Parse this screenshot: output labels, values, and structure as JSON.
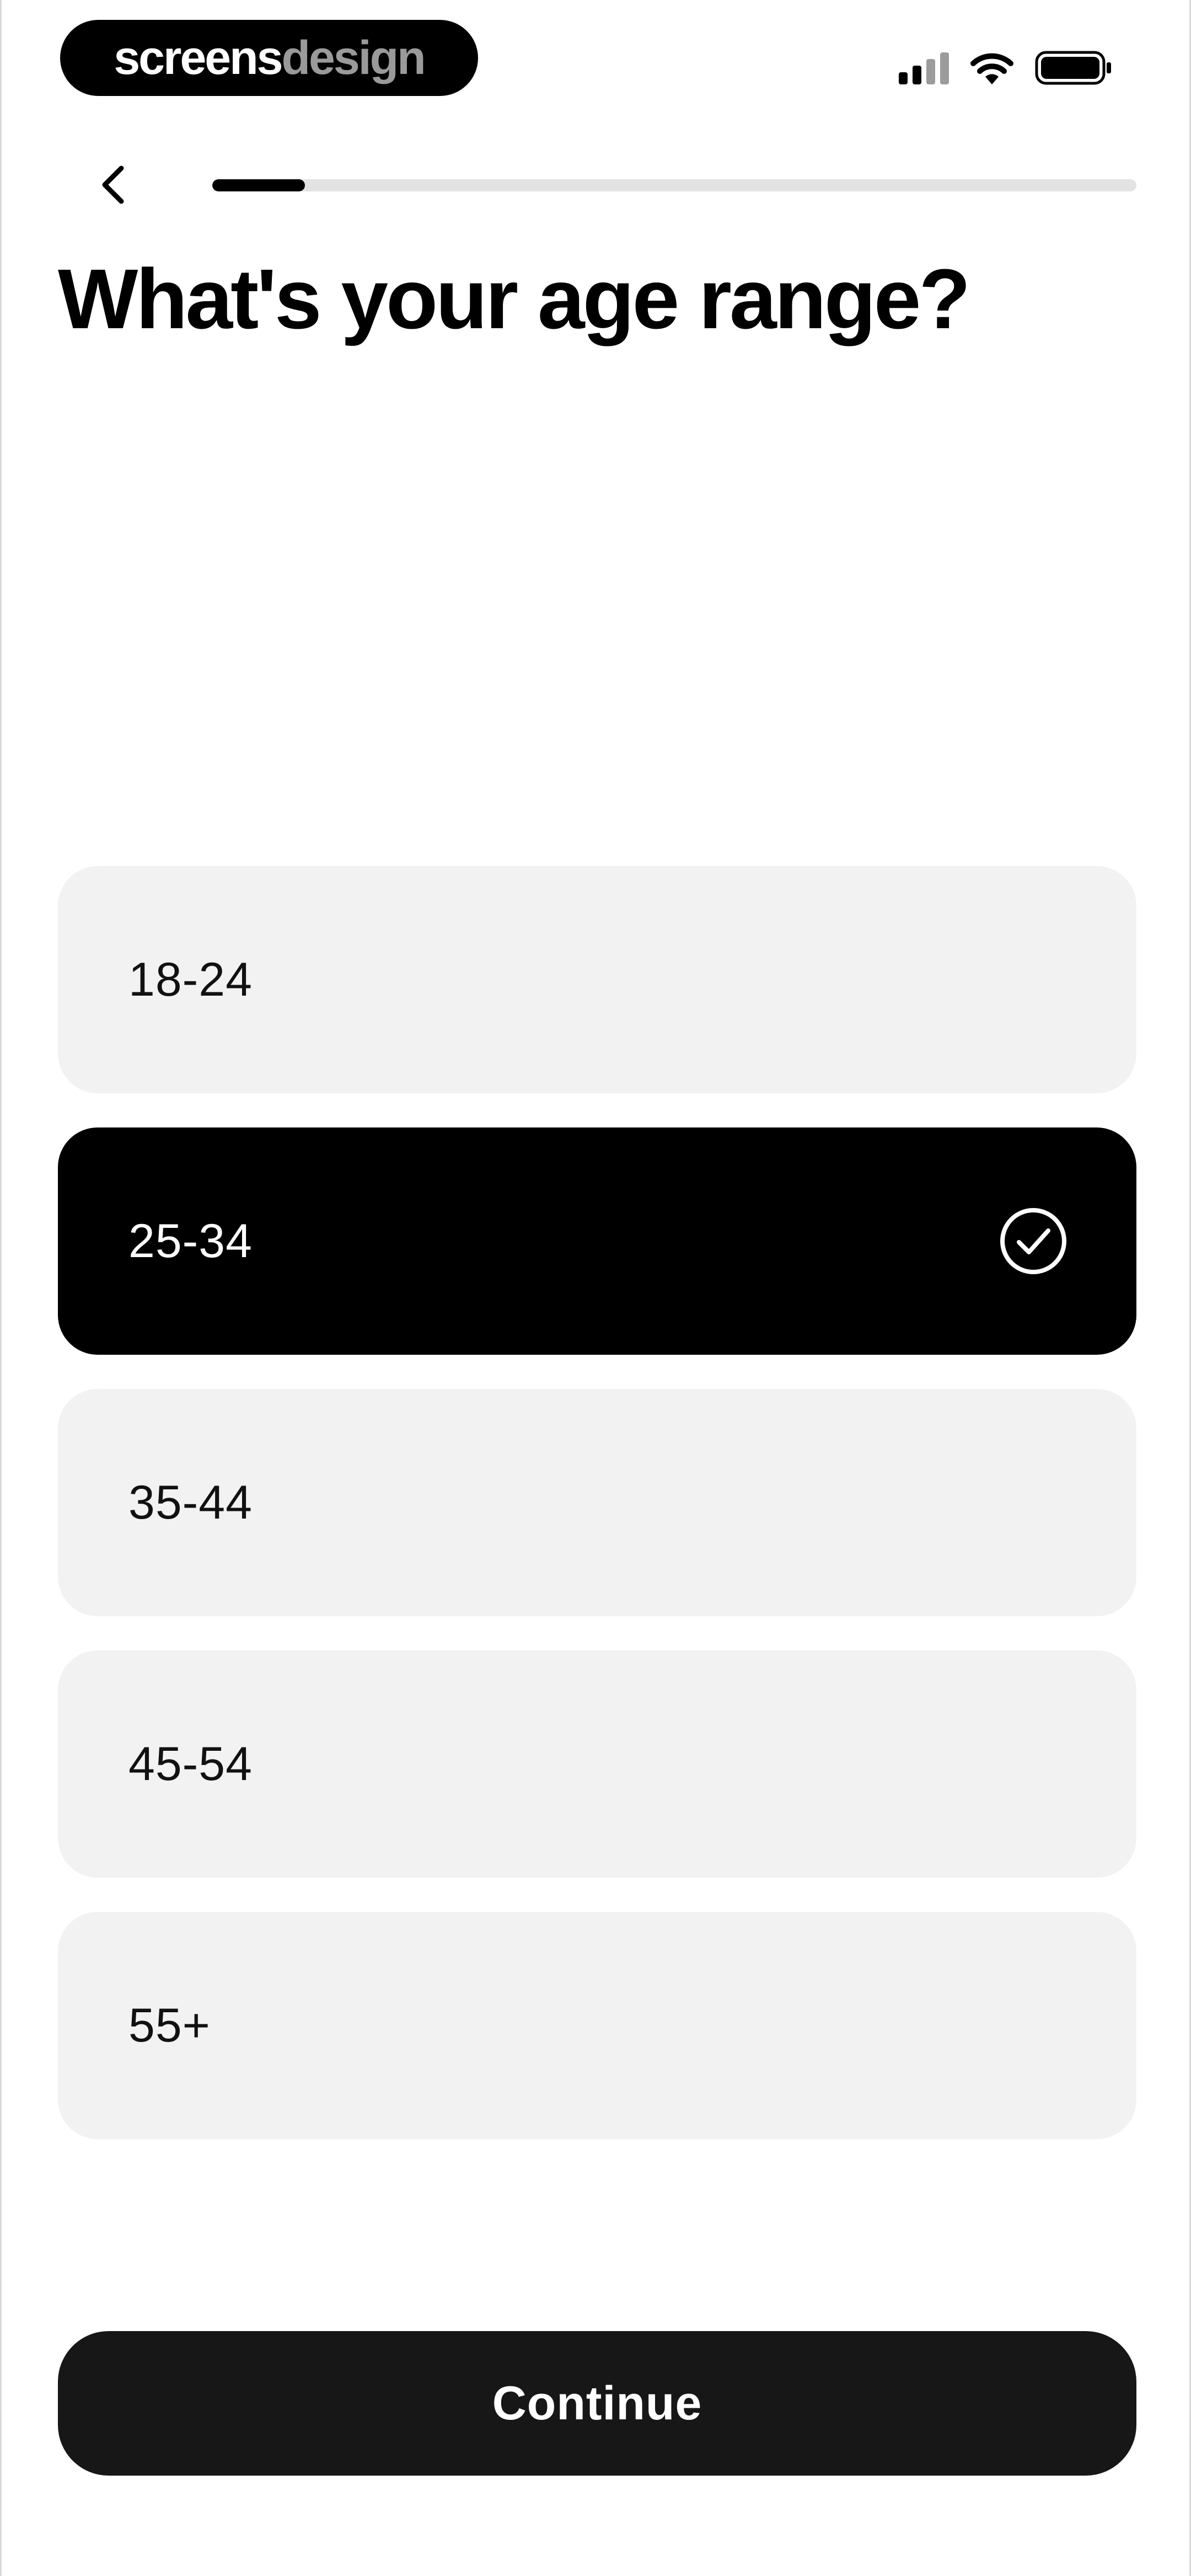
{
  "status_bar": {
    "brand_part1": "screens",
    "brand_part2": "design"
  },
  "header": {
    "progress_fraction": 0.1,
    "title": "What's your age range?"
  },
  "options": [
    {
      "label": "18-24",
      "selected": false
    },
    {
      "label": "25-34",
      "selected": true
    },
    {
      "label": "35-44",
      "selected": false
    },
    {
      "label": "45-54",
      "selected": false
    },
    {
      "label": "55+",
      "selected": false
    }
  ],
  "continue_label": "Continue",
  "colors": {
    "selected_bg": "#000000",
    "option_bg": "#f2f2f2",
    "button_bg": "#171717",
    "progress_track": "#e3e3e3"
  },
  "icons": {
    "back": "chevron-left-icon",
    "check": "check-circle-icon",
    "wifi": "wifi-icon",
    "battery": "battery-icon",
    "signal": "signal-icon"
  }
}
